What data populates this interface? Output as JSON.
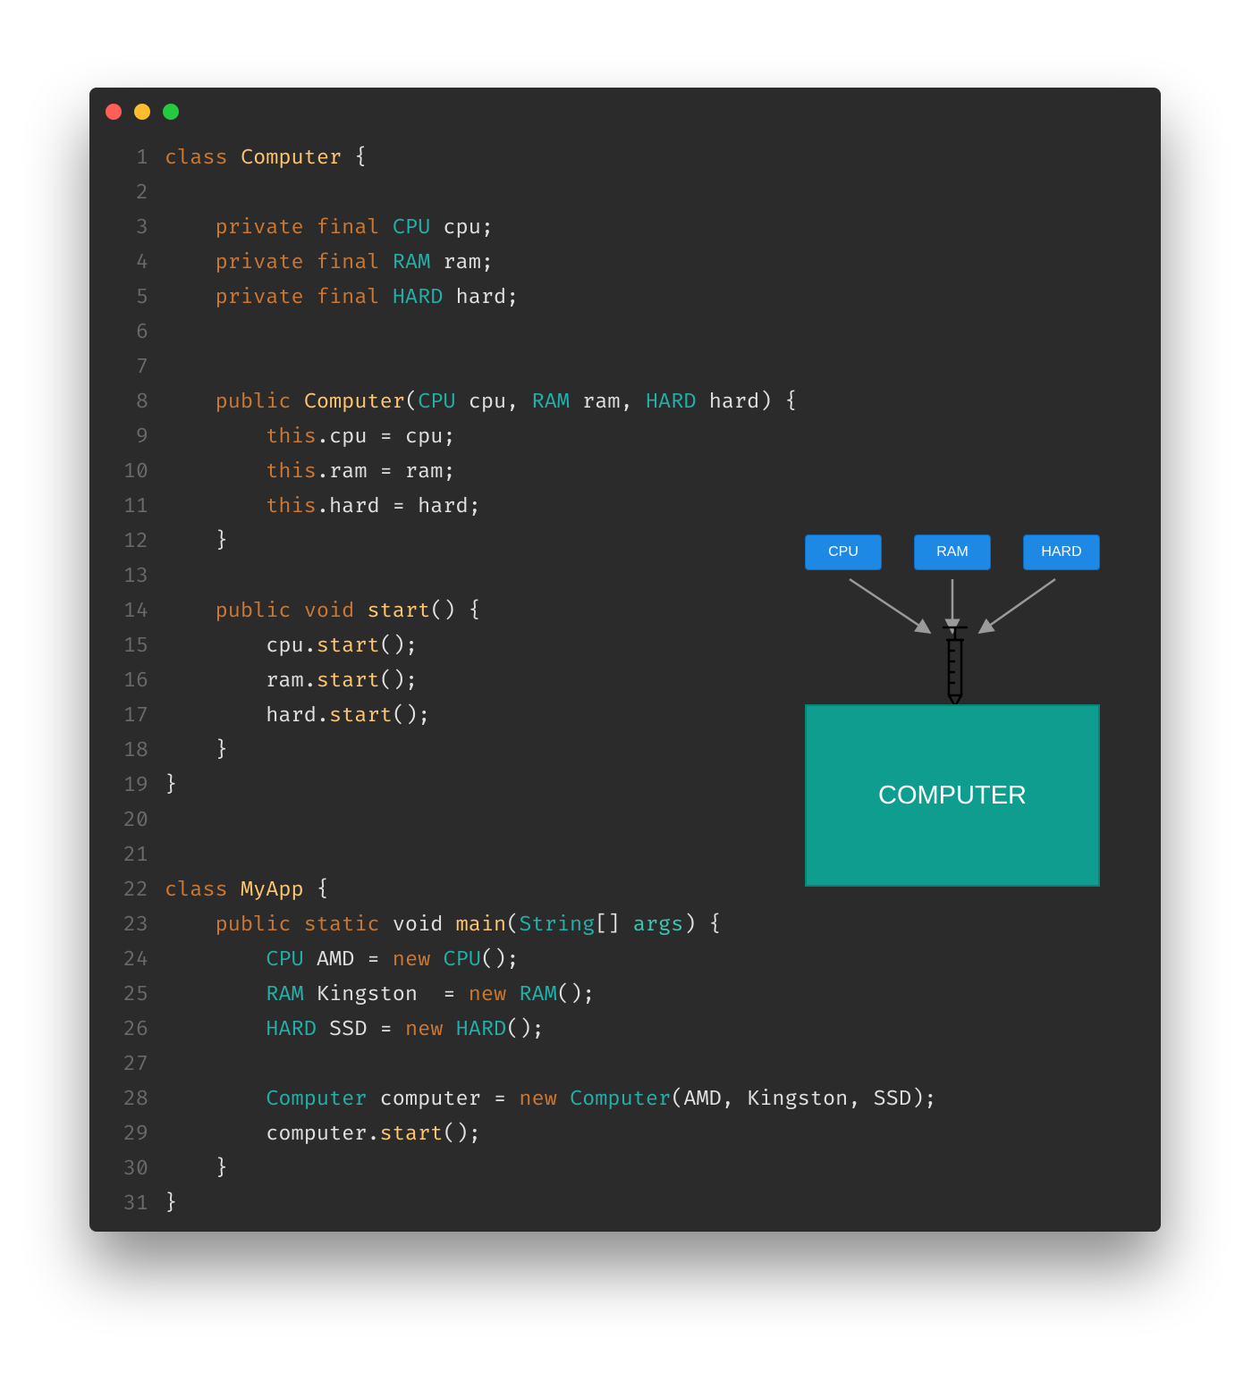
{
  "code": {
    "lines": [
      [
        [
          "kw",
          "class "
        ],
        [
          "classN",
          "Computer"
        ],
        [
          "plain",
          " {"
        ]
      ],
      [],
      [
        [
          "plain",
          "    "
        ],
        [
          "kw",
          "private final "
        ],
        [
          "type",
          "CPU "
        ],
        [
          "plain",
          "cpu;"
        ]
      ],
      [
        [
          "plain",
          "    "
        ],
        [
          "kw",
          "private final "
        ],
        [
          "type",
          "RAM "
        ],
        [
          "plain",
          "ram;"
        ]
      ],
      [
        [
          "plain",
          "    "
        ],
        [
          "kw",
          "private final "
        ],
        [
          "type",
          "HARD "
        ],
        [
          "plain",
          "hard;"
        ]
      ],
      [],
      [],
      [
        [
          "plain",
          "    "
        ],
        [
          "kw",
          "public "
        ],
        [
          "classN",
          "Computer"
        ],
        [
          "plain",
          "("
        ],
        [
          "type",
          "CPU "
        ],
        [
          "plain",
          "cpu, "
        ],
        [
          "type",
          "RAM "
        ],
        [
          "plain",
          "ram, "
        ],
        [
          "type",
          "HARD "
        ],
        [
          "plain",
          "hard) {"
        ]
      ],
      [
        [
          "plain",
          "        "
        ],
        [
          "kw",
          "this"
        ],
        [
          "plain",
          ".cpu = cpu;"
        ]
      ],
      [
        [
          "plain",
          "        "
        ],
        [
          "kw",
          "this"
        ],
        [
          "plain",
          ".ram = ram;"
        ]
      ],
      [
        [
          "plain",
          "        "
        ],
        [
          "kw",
          "this"
        ],
        [
          "plain",
          ".hard = hard;"
        ]
      ],
      [
        [
          "plain",
          "    }"
        ]
      ],
      [],
      [
        [
          "plain",
          "    "
        ],
        [
          "kw",
          "public void "
        ],
        [
          "fn",
          "start"
        ],
        [
          "plain",
          "() {"
        ]
      ],
      [
        [
          "plain",
          "        cpu."
        ],
        [
          "fn",
          "start"
        ],
        [
          "plain",
          "();"
        ]
      ],
      [
        [
          "plain",
          "        ram."
        ],
        [
          "fn",
          "start"
        ],
        [
          "plain",
          "();"
        ]
      ],
      [
        [
          "plain",
          "        hard."
        ],
        [
          "fn",
          "start"
        ],
        [
          "plain",
          "();"
        ]
      ],
      [
        [
          "plain",
          "    }"
        ]
      ],
      [
        [
          "plain",
          "}"
        ]
      ],
      [],
      [],
      [
        [
          "kw",
          "class "
        ],
        [
          "classN",
          "MyApp"
        ],
        [
          "plain",
          " {"
        ]
      ],
      [
        [
          "plain",
          "    "
        ],
        [
          "kw",
          "public static "
        ],
        [
          "plain",
          "void "
        ],
        [
          "fn",
          "main"
        ],
        [
          "plain",
          "("
        ],
        [
          "type",
          "String"
        ],
        [
          "plain",
          "[] "
        ],
        [
          "special",
          "args"
        ],
        [
          "plain",
          ") {"
        ]
      ],
      [
        [
          "plain",
          "        "
        ],
        [
          "type",
          "CPU "
        ],
        [
          "plain",
          "AMD = "
        ],
        [
          "kw",
          "new "
        ],
        [
          "type",
          "CPU"
        ],
        [
          "plain",
          "();"
        ]
      ],
      [
        [
          "plain",
          "        "
        ],
        [
          "type",
          "RAM "
        ],
        [
          "plain",
          "Kingston  = "
        ],
        [
          "kw",
          "new "
        ],
        [
          "type",
          "RAM"
        ],
        [
          "plain",
          "();"
        ]
      ],
      [
        [
          "plain",
          "        "
        ],
        [
          "type",
          "HARD "
        ],
        [
          "plain",
          "SSD = "
        ],
        [
          "kw",
          "new "
        ],
        [
          "type",
          "HARD"
        ],
        [
          "plain",
          "();"
        ]
      ],
      [],
      [
        [
          "plain",
          "        "
        ],
        [
          "type",
          "Computer "
        ],
        [
          "plain",
          "computer = "
        ],
        [
          "kw",
          "new "
        ],
        [
          "type",
          "Computer"
        ],
        [
          "plain",
          "(AMD, Kingston, SSD);"
        ]
      ],
      [
        [
          "plain",
          "        computer."
        ],
        [
          "fn",
          "start"
        ],
        [
          "plain",
          "();"
        ]
      ],
      [
        [
          "plain",
          "    }"
        ]
      ],
      [
        [
          "plain",
          "}"
        ]
      ]
    ]
  },
  "diagram": {
    "dep1": "CPU",
    "dep2": "RAM",
    "dep3": "HARD",
    "target": "COMPUTER"
  }
}
